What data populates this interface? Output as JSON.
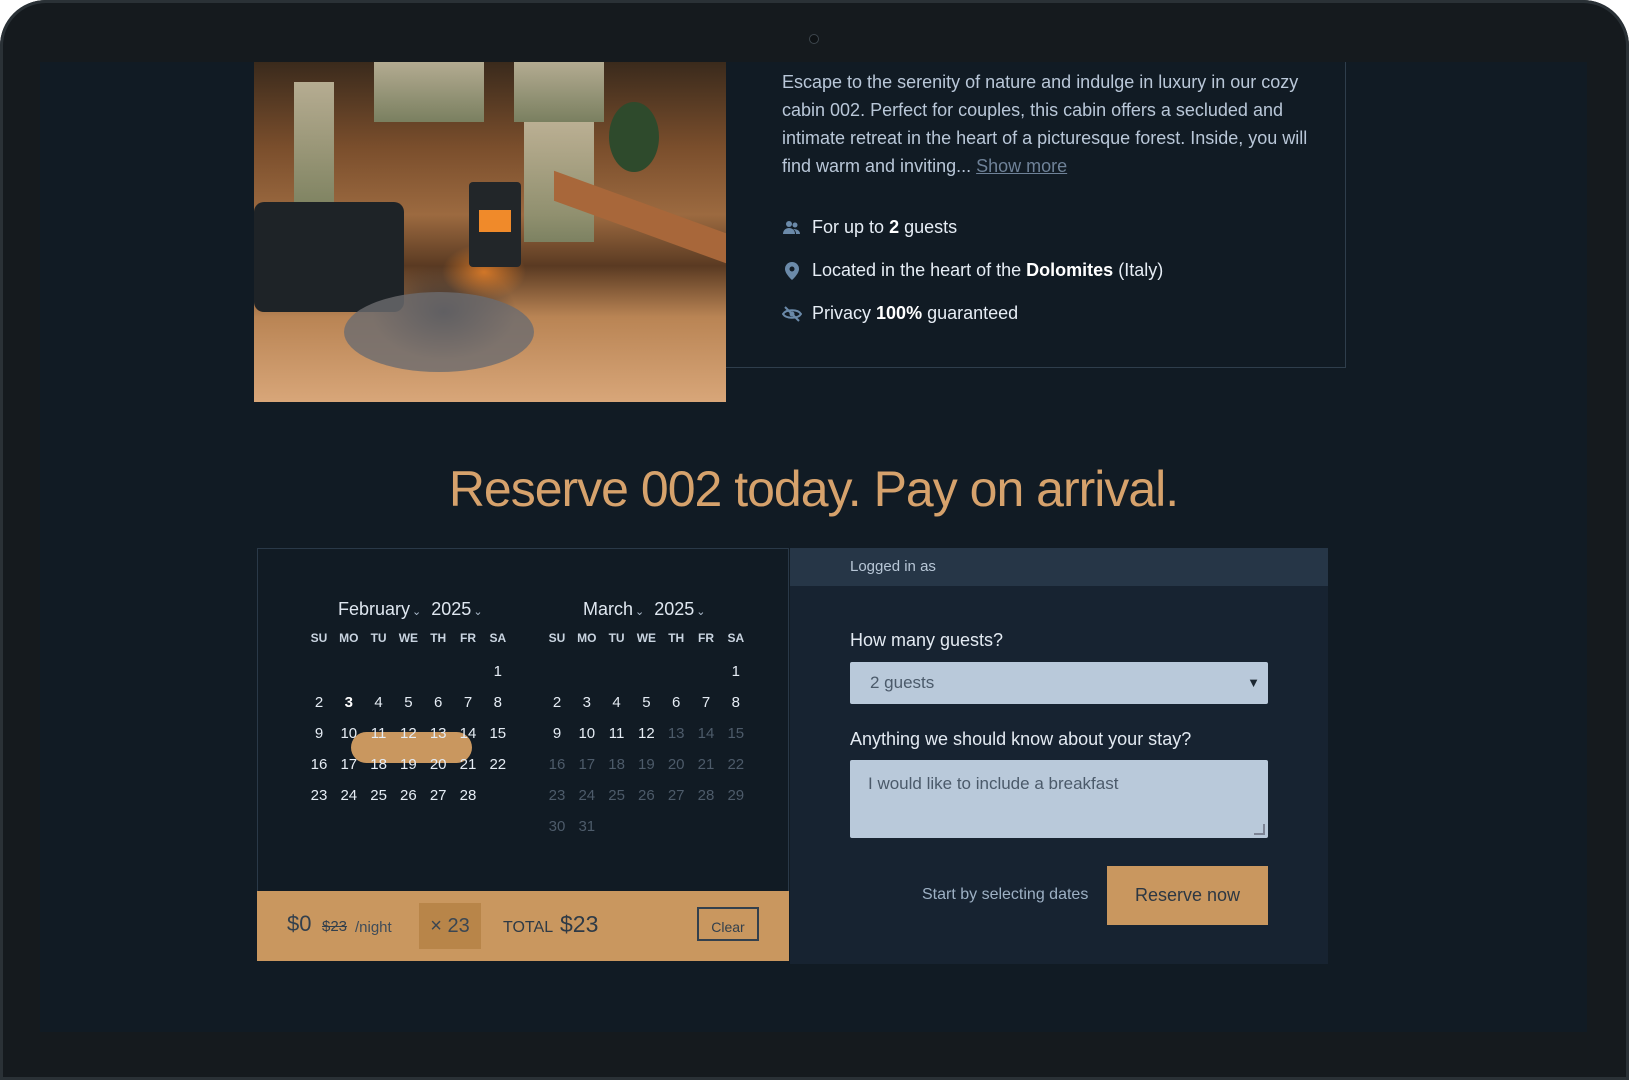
{
  "listing": {
    "description": "Escape to the serenity of nature and indulge in luxury in our cozy cabin 002. Perfect for couples, this cabin offers a secluded and intimate retreat in the heart of a picturesque forest. Inside, you will find warm and inviting...",
    "show_more": "Show more",
    "features": [
      {
        "icon": "guests-icon",
        "pre": "For up to ",
        "bold": "2",
        "post": " guests"
      },
      {
        "icon": "location-pin-icon",
        "pre": "Located in the heart of the ",
        "bold": "Dolomites",
        "post": " (Italy)"
      },
      {
        "icon": "eye-slash-icon",
        "pre": "Privacy ",
        "bold": "100%",
        "post": " guaranteed"
      }
    ]
  },
  "headline": "Reserve 002 today. Pay on arrival.",
  "calendar": {
    "dow": [
      "SU",
      "MO",
      "TU",
      "WE",
      "TH",
      "FR",
      "SA"
    ],
    "months": [
      {
        "month": "February",
        "year": "2025"
      },
      {
        "month": "March",
        "year": "2025"
      }
    ]
  },
  "price_bar": {
    "price": "$0",
    "old_price": "$23",
    "per_night": "/night",
    "multiplier": "× 23",
    "total_label": "TOTAL",
    "total_value": "$23",
    "clear": "Clear"
  },
  "form": {
    "logged_in": "Logged in as",
    "guests_label": "How many guests?",
    "guests_value": "2 guests",
    "notes_label": "Anything we should know about your stay?",
    "notes_value": "I would like to include a breakfast",
    "hint": "Start by selecting dates",
    "reserve": "Reserve now"
  },
  "colors": {
    "accent": "#c9975f",
    "background": "#111b24",
    "panel": "#172331"
  }
}
